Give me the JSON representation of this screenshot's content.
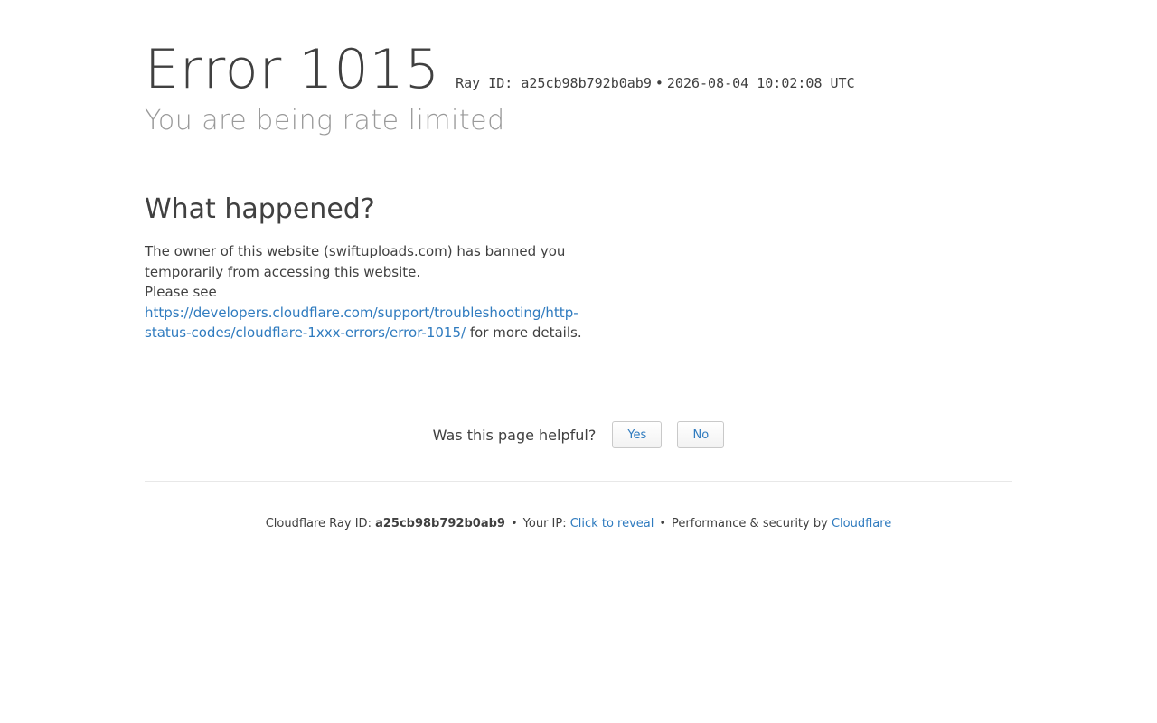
{
  "header": {
    "error_word": "Error",
    "error_code": "1015",
    "ray_label": "Ray ID: a25cb98b792b0ab9",
    "bullet": "•",
    "timestamp": "2026-08-04 10:02:08 UTC",
    "subtitle": "You are being rate limited"
  },
  "main": {
    "heading": "What happened?",
    "text1": "The owner of this website (swiftuploads.com) has banned you temporarily from accessing this website.",
    "please_see": "Please see",
    "link": "https://developers.cloudflare.com/support/troubleshooting/http-status-codes/cloudflare-1xxx-errors/error-1015/",
    "more": "for more details."
  },
  "feedback": {
    "question": "Was this page helpful?",
    "yes_label": "Yes",
    "no_label": "No"
  },
  "footer": {
    "ray_label": "Cloudflare Ray ID:",
    "ray_id": "a25cb98b792b0ab9",
    "bullet": "•",
    "ip_label": "Your IP:",
    "ip_link": "Click to reveal",
    "perf_label": "Performance & security by",
    "brand_link": "Cloudflare"
  },
  "colors": {
    "link": "#2f7bbf",
    "text": "#404040",
    "muted": "#9a9a9a"
  }
}
